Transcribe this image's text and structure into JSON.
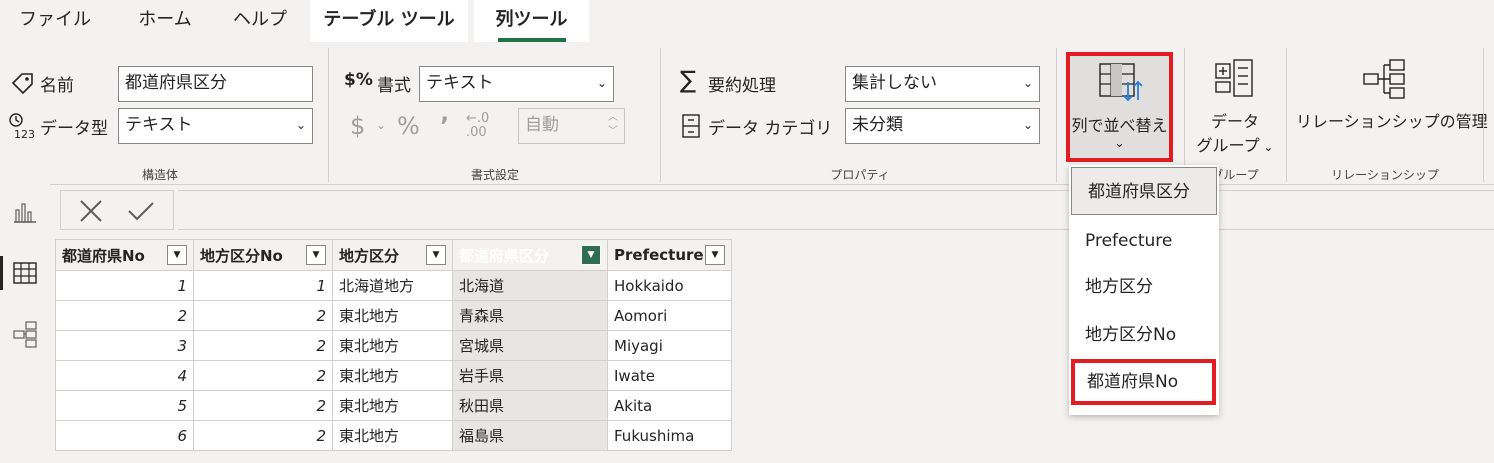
{
  "menu": {
    "tabs": [
      {
        "label": "ファイル"
      },
      {
        "label": "ホーム"
      },
      {
        "label": "ヘルプ"
      },
      {
        "label": "テーブル ツール"
      },
      {
        "label": "列ツール"
      }
    ]
  },
  "ribbon": {
    "structure": {
      "name_label": "名前",
      "name_value": "都道府県区分",
      "datatype_label": "データ型",
      "datatype_value": "テキスト",
      "group_label": "構造体"
    },
    "format": {
      "format_label": "書式",
      "format_value": "テキスト",
      "auto_value": "自動",
      "group_label": "書式設定"
    },
    "properties": {
      "summarize_label": "要約処理",
      "summarize_value": "集計しない",
      "category_label": "データ カテゴリ",
      "category_value": "未分類",
      "group_label": "プロパティ"
    },
    "sort": {
      "label": "列で並べ替え"
    },
    "groups": {
      "label_line1": "データ",
      "label_line2": "グループ",
      "group_label": "グループ"
    },
    "relationships": {
      "label": "リレーションシップの管理",
      "group_label": "リレーションシップ"
    }
  },
  "sort_dropdown": {
    "items": [
      {
        "label": "都道府県区分"
      },
      {
        "label": "Prefecture"
      },
      {
        "label": "地方区分"
      },
      {
        "label": "地方区分No"
      },
      {
        "label": "都道府県No"
      }
    ]
  },
  "table": {
    "columns": [
      {
        "label": "都道府県No"
      },
      {
        "label": "地方区分No"
      },
      {
        "label": "地方区分"
      },
      {
        "label": "都道府県区分"
      },
      {
        "label": "Prefecture"
      }
    ],
    "rows": [
      {
        "c1": "1",
        "c2": "1",
        "c3": "北海道地方",
        "c4": "北海道",
        "c5": "Hokkaido"
      },
      {
        "c1": "2",
        "c2": "2",
        "c3": "東北地方",
        "c4": "青森県",
        "c5": "Aomori"
      },
      {
        "c1": "3",
        "c2": "2",
        "c3": "東北地方",
        "c4": "宮城県",
        "c5": "Miyagi"
      },
      {
        "c1": "4",
        "c2": "2",
        "c3": "東北地方",
        "c4": "岩手県",
        "c5": "Iwate"
      },
      {
        "c1": "5",
        "c2": "2",
        "c3": "東北地方",
        "c4": "秋田県",
        "c5": "Akita"
      },
      {
        "c1": "6",
        "c2": "2",
        "c3": "東北地方",
        "c4": "福島県",
        "c5": "Fukushima"
      }
    ]
  },
  "colors": {
    "accent": "#217346",
    "selected_header": "#2f6b55",
    "highlight": "#e31b23"
  }
}
